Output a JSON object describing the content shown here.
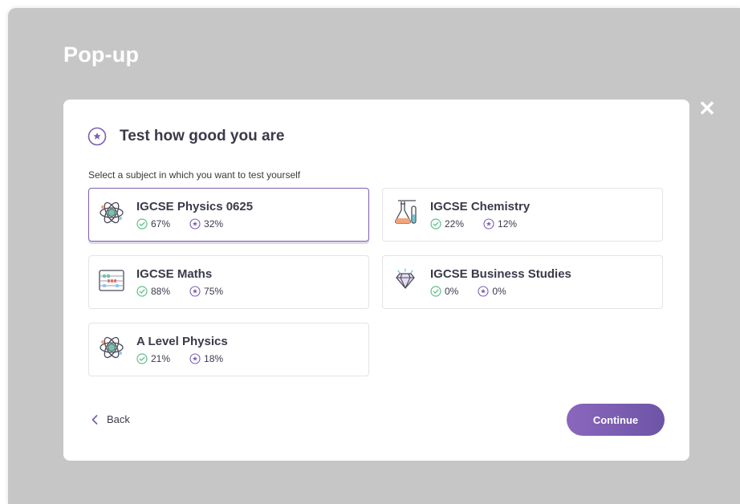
{
  "page": {
    "title": "Pop-up"
  },
  "modal": {
    "title": "Test how good you are",
    "subtitle": "Select a subject in which you want to test yourself",
    "back_label": "Back",
    "continue_label": "Continue",
    "close_label": "✕"
  },
  "subjects": [
    {
      "title": "IGCSE Physics 0625",
      "completion": "67%",
      "score": "32%",
      "icon": "atom-icon",
      "selected": true
    },
    {
      "title": "IGCSE Chemistry",
      "completion": "22%",
      "score": "12%",
      "icon": "lab-flasks-icon",
      "selected": false
    },
    {
      "title": "IGCSE Maths",
      "completion": "88%",
      "score": "75%",
      "icon": "abacus-icon",
      "selected": false
    },
    {
      "title": "IGCSE Business Studies",
      "completion": "0%",
      "score": "0%",
      "icon": "diamond-icon",
      "selected": false
    },
    {
      "title": "A Level Physics",
      "completion": "21%",
      "score": "18%",
      "icon": "atom-icon",
      "selected": false
    }
  ],
  "colors": {
    "accent": "#7b5fae",
    "check_green": "#5cbf8a",
    "backdrop": "#c6c6c6"
  }
}
